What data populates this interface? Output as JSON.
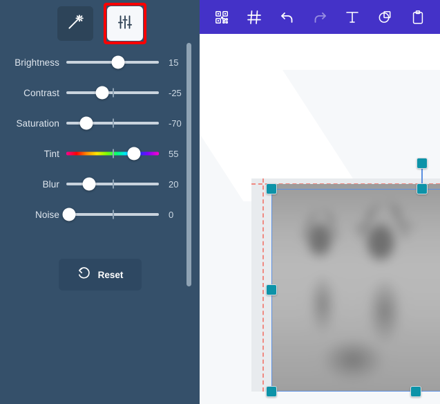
{
  "left_panel": {
    "background_color": "#35506a",
    "mode_tabs": [
      {
        "name": "auto-enhance",
        "icon": "magic-wand-icon",
        "active": false
      },
      {
        "name": "adjustments",
        "icon": "sliders-icon",
        "active": true,
        "highlighted": true,
        "highlight_color": "#ff0000"
      }
    ],
    "sliders": [
      {
        "label": "Brightness",
        "value": "15",
        "percent": 55,
        "gradient": false,
        "tick": false
      },
      {
        "label": "Contrast",
        "value": "-25",
        "percent": 38,
        "gradient": false,
        "tick": true
      },
      {
        "label": "Saturation",
        "value": "-70",
        "percent": 21,
        "gradient": false,
        "tick": true
      },
      {
        "label": "Tint",
        "value": "55",
        "percent": 72,
        "gradient": true,
        "tick": true
      },
      {
        "label": "Blur",
        "value": "20",
        "percent": 24,
        "gradient": false,
        "tick": true
      },
      {
        "label": "Noise",
        "value": "0",
        "percent": 3,
        "gradient": false,
        "tick": true
      }
    ],
    "reset_button": {
      "label": "Reset",
      "icon": "undo-rotate-icon"
    },
    "scrollbar": {
      "name": "panel-scrollbar"
    }
  },
  "editor": {
    "toolbar": {
      "background_color": "#4432c8",
      "items": [
        {
          "name": "qr-code-icon",
          "label": "QR Code",
          "disabled": false
        },
        {
          "name": "grid-icon",
          "label": "Grid",
          "disabled": false
        },
        {
          "name": "undo-icon",
          "label": "Undo",
          "disabled": false
        },
        {
          "name": "redo-icon",
          "label": "Redo",
          "disabled": true
        },
        {
          "name": "text-icon",
          "label": "Text",
          "disabled": false
        },
        {
          "name": "sticker-icon",
          "label": "Sticker",
          "disabled": false
        },
        {
          "name": "clipboard-icon",
          "label": "Clipboard",
          "disabled": false
        }
      ]
    },
    "canvas": {
      "background_color": "#f6f8fa",
      "image": {
        "name": "deer-photo",
        "description": "blurred grayscale photo of two deer"
      },
      "selection": {
        "border_color": "#5b8fe0",
        "handle_color": "#0d93a8",
        "guide_color": "#f08a82",
        "handles": [
          {
            "name": "handle-top-left"
          },
          {
            "name": "handle-top-right"
          },
          {
            "name": "handle-middle-left"
          },
          {
            "name": "handle-bottom-left"
          },
          {
            "name": "handle-bottom-right"
          },
          {
            "name": "handle-rotate"
          }
        ]
      }
    }
  }
}
